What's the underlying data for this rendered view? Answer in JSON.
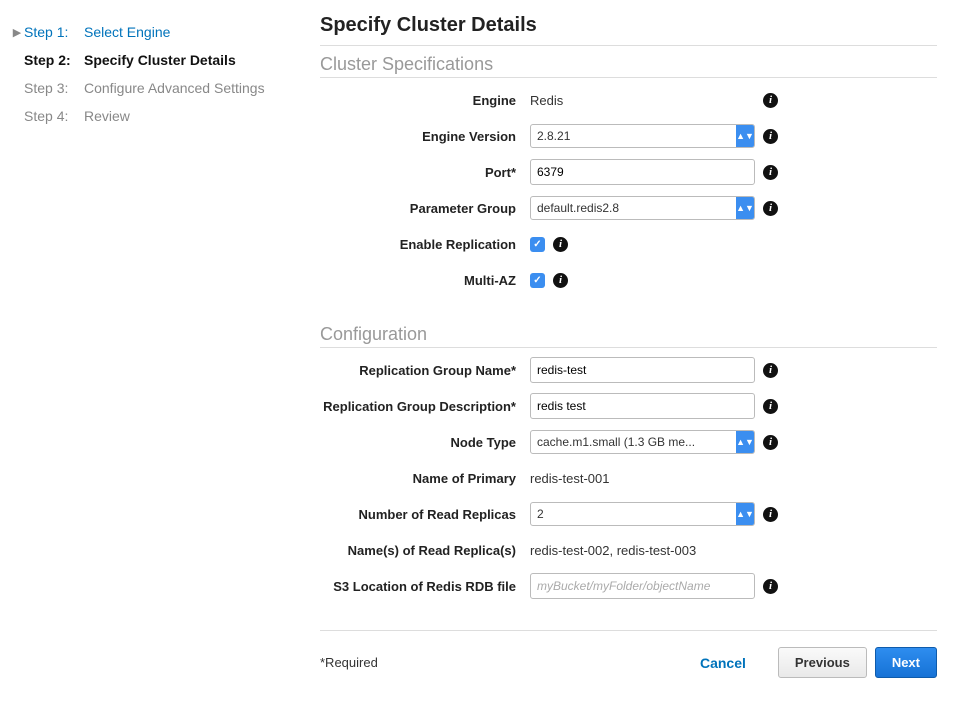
{
  "steps": [
    {
      "num": "Step 1:",
      "label": "Select Engine"
    },
    {
      "num": "Step 2:",
      "label": "Specify Cluster Details"
    },
    {
      "num": "Step 3:",
      "label": "Configure Advanced Settings"
    },
    {
      "num": "Step 4:",
      "label": "Review"
    }
  ],
  "page_title": "Specify Cluster Details",
  "sections": {
    "spec_head": "Cluster Specifications",
    "config_head": "Configuration"
  },
  "labels": {
    "engine": "Engine",
    "engine_version": "Engine Version",
    "port": "Port*",
    "parameter_group": "Parameter Group",
    "enable_replication": "Enable Replication",
    "multi_az": "Multi-AZ",
    "rep_group_name": "Replication Group Name*",
    "rep_group_desc": "Replication Group Description*",
    "node_type": "Node Type",
    "name_primary": "Name of Primary",
    "num_replicas": "Number of Read Replicas",
    "names_replicas": "Name(s) of Read Replica(s)",
    "s3_rdb": "S3 Location of Redis RDB file"
  },
  "values": {
    "engine": "Redis",
    "engine_version": "2.8.21",
    "port": "6379",
    "parameter_group": "default.redis2.8",
    "enable_replication_checked": true,
    "multi_az_checked": true,
    "rep_group_name": "redis-test",
    "rep_group_desc": "redis test",
    "node_type": "cache.m1.small (1.3 GB me...",
    "name_primary": "redis-test-001",
    "num_replicas": "2",
    "names_replicas": "redis-test-002, redis-test-003",
    "s3_rdb": "",
    "s3_rdb_placeholder": "myBucket/myFolder/objectName"
  },
  "footer": {
    "required_note": "*Required",
    "cancel": "Cancel",
    "previous": "Previous",
    "next": "Next"
  }
}
